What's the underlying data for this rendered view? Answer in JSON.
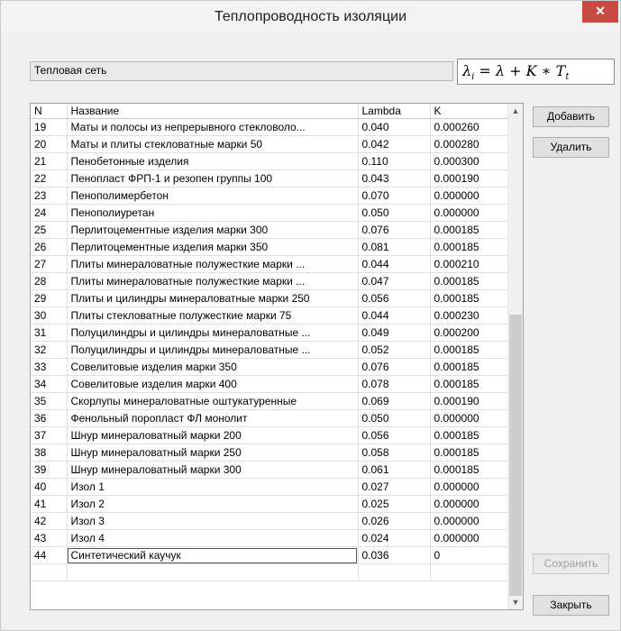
{
  "window": {
    "title": "Теплопроводность изоляции",
    "close_glyph": "✕"
  },
  "header_field": {
    "value": "Тепловая сеть"
  },
  "formula": "λi = λ + K * Tt",
  "table": {
    "columns": [
      "N",
      "Название",
      "Lambda",
      "K"
    ],
    "rows": [
      [
        "19",
        "Маты и полосы из непрерывного стекловоло...",
        "0.040",
        "0.000260"
      ],
      [
        "20",
        "Маты и плиты стекловатные марки 50",
        "0.042",
        "0.000280"
      ],
      [
        "21",
        "Пенобетонные изделия",
        "0.110",
        "0.000300"
      ],
      [
        "22",
        "Пенопласт ФРП-1 и резопен группы 100",
        "0.043",
        "0.000190"
      ],
      [
        "23",
        "Пенополимербетон",
        "0.070",
        "0.000000"
      ],
      [
        "24",
        "Пенополиуретан",
        "0.050",
        "0.000000"
      ],
      [
        "25",
        "Перлитоцементные изделия марки 300",
        "0.076",
        "0.000185"
      ],
      [
        "26",
        "Перлитоцементные изделия марки 350",
        "0.081",
        "0.000185"
      ],
      [
        "27",
        "Плиты минераловатные полужесткие марки ...",
        "0.044",
        "0.000210"
      ],
      [
        "28",
        "Плиты минераловатные полужесткие марки ...",
        "0.047",
        "0.000185"
      ],
      [
        "29",
        "Плиты и цилиндры минераловатные марки 250",
        "0.056",
        "0.000185"
      ],
      [
        "30",
        "Плиты стекловатные полужесткие марки 75",
        "0.044",
        "0.000230"
      ],
      [
        "31",
        "Полуцилиндры и цилиндры минераловатные ...",
        "0.049",
        "0.000200"
      ],
      [
        "32",
        "Полуцилиндры и цилиндры минераловатные ...",
        "0.052",
        "0.000185"
      ],
      [
        "33",
        "Совелитовые изделия марки 350",
        "0.076",
        "0.000185"
      ],
      [
        "34",
        "Совелитовые изделия марки 400",
        "0.078",
        "0.000185"
      ],
      [
        "35",
        "Скорлупы минераловатные оштукатуренные",
        "0.069",
        "0.000190"
      ],
      [
        "36",
        "Фенольный поропласт ФЛ монолит",
        "0.050",
        "0.000000"
      ],
      [
        "37",
        "Шнур минераловатный марки 200",
        "0.056",
        "0.000185"
      ],
      [
        "38",
        "Шнур минераловатный марки 250",
        "0.058",
        "0.000185"
      ],
      [
        "39",
        "Шнур минераловатный марки 300",
        "0.061",
        "0.000185"
      ],
      [
        "40",
        "Изол 1",
        "0.027",
        "0.000000"
      ],
      [
        "41",
        "Изол 2",
        "0.025",
        "0.000000"
      ],
      [
        "42",
        "Изол 3",
        "0.026",
        "0.000000"
      ],
      [
        "43",
        "Изол 4",
        "0.024",
        "0.000000"
      ],
      [
        "44",
        "Синтетический каучук",
        "0.036",
        "0"
      ],
      [
        "",
        "",
        "",
        ""
      ]
    ]
  },
  "buttons": {
    "add": "Добавить",
    "delete": "Удалить",
    "save": "Сохранить",
    "close": "Закрыть"
  },
  "scrollbar": {
    "up_glyph": "▲",
    "down_glyph": "▼"
  }
}
